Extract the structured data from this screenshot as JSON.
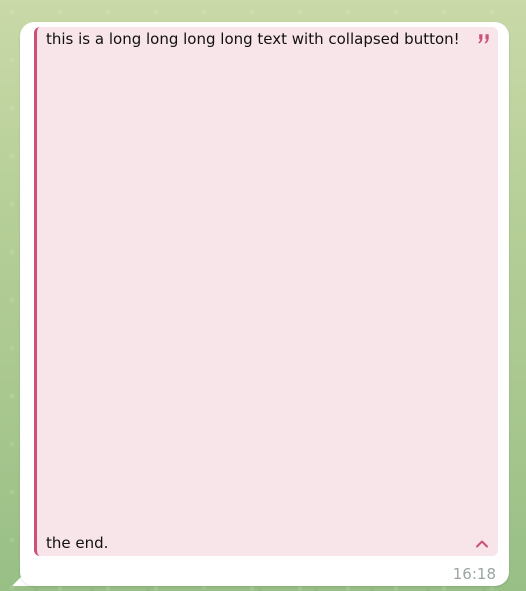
{
  "message": {
    "quote_text_start": "this is a long long long long text with collapsed button!",
    "quote_text_end": "the end.",
    "time": "16:18"
  },
  "icons": {
    "quote": "quote-icon",
    "collapse": "chevron-up-icon"
  },
  "colors": {
    "accent": "#cc5078",
    "quote_background": "#f8e5ea",
    "bubble": "#ffffff",
    "time": "#9aa6a1"
  }
}
